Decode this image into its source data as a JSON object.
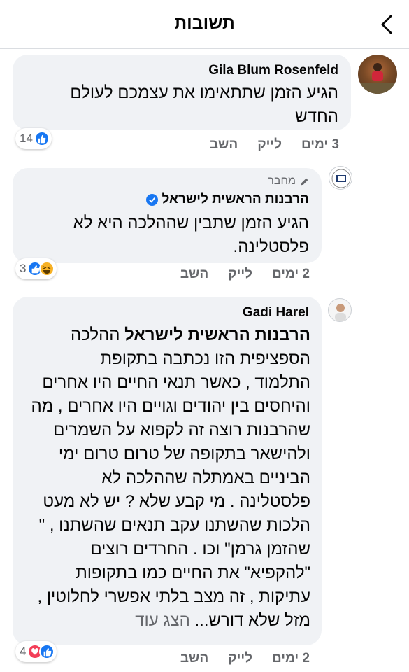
{
  "header": {
    "title": "תשובות"
  },
  "comments": [
    {
      "author": "Gila Blum Rosenfeld",
      "text_lines": [
        "הגיע הזמן שתתאימו את עצמכם לעולם",
        "החדש"
      ],
      "time": "3 ימים",
      "like_label": "לייק",
      "reply_label": "השב",
      "reaction_count": "14"
    },
    {
      "badge": "מחבר",
      "author": "הרבנות הראשית לישראל",
      "text_lines": [
        "הגיע הזמן שתבין שההלכה היא לא",
        "פלסטלינה."
      ],
      "time": "2 ימים",
      "like_label": "לייק",
      "reply_label": "השב",
      "reaction_count": "3"
    },
    {
      "author": "Gadi Harel",
      "mention": "הרבנות הראשית לישראל",
      "first_line_rest": " ההלכה",
      "text_lines": [
        "הספציפית הזו נכתבה בתקופת",
        "התלמוד , כאשר תנאי החיים היו אחרים",
        "והיחסים בין יהודים וגויים היו אחרים , מה",
        "שהרבנות רוצה זה לקפוא על השמרים",
        "ולהישאר בתקופה של טרום טרום ימי",
        "הביניים באמתלה  שההלכה לא",
        "פלסטלינה . מי קבע שלא ? יש לא מעט",
        "הלכות שהשתנו עקב תנאים שהשתנו , \"",
        "שהזמן גרמן\"  וכו .  החרדים רוצים",
        "\"להקפיא\"  את החיים כמו בתקופות",
        "עתיקות , זה מצב בלתי אפשרי לחלוטין ,"
      ],
      "last_line_text": "מזל שלא דורש...",
      "see_more": "הצג עוד",
      "time": "2 ימים",
      "like_label": "לייק",
      "reply_label": "השב",
      "reaction_count": "4"
    }
  ],
  "colors": {
    "like": "#1877f2",
    "love": "#f33e58",
    "haha": "#f7b125",
    "bubble": "#f0f2f5",
    "muted": "#65676b"
  }
}
